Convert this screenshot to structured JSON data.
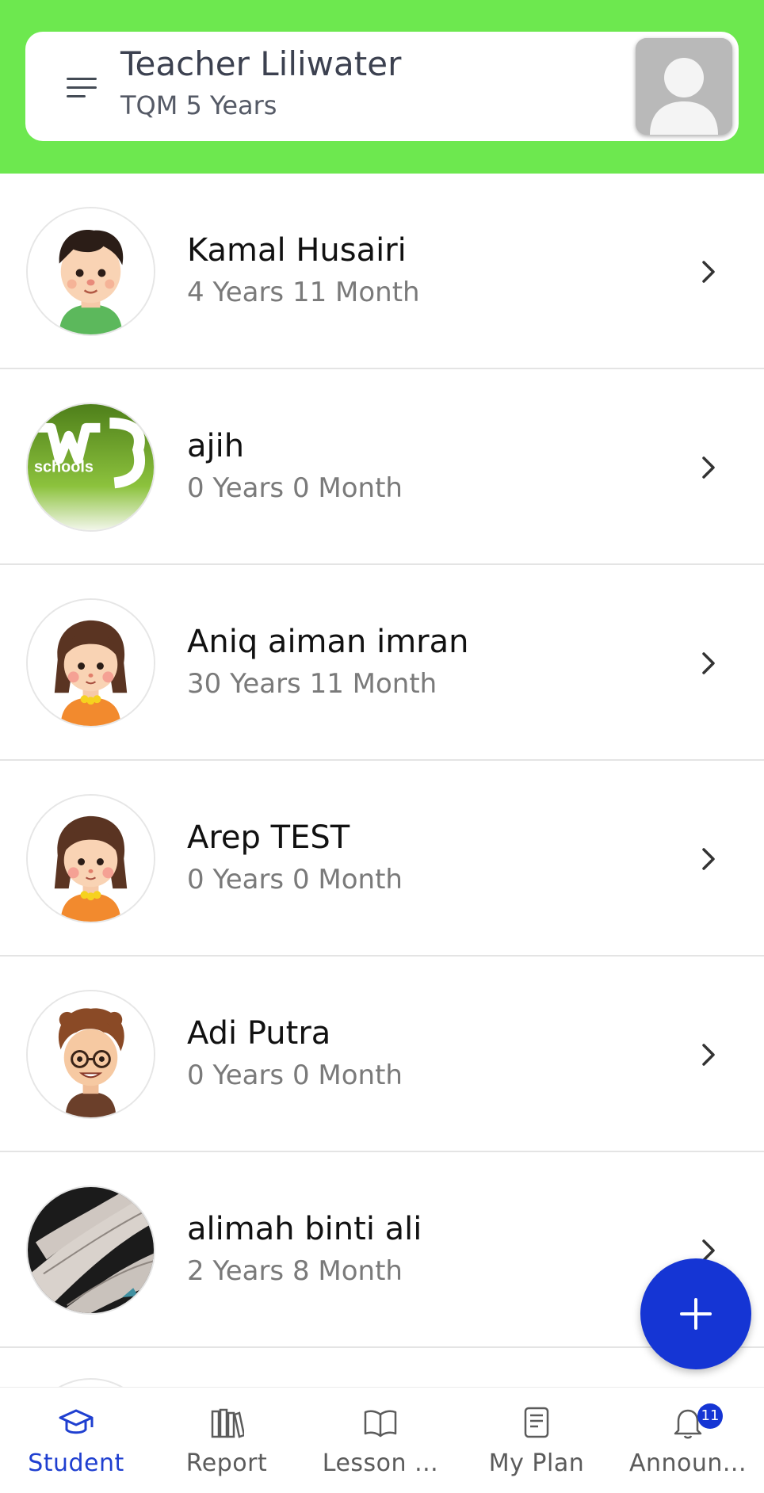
{
  "header": {
    "teacher_name": "Teacher Liliwater",
    "teacher_subtitle": "TQM 5 Years",
    "background_color": "#6de84f"
  },
  "students": [
    {
      "name": "Kamal Husairi",
      "age": "4 Years 11 Month",
      "avatar": "cartoon-boy-avatar"
    },
    {
      "name": "ajih",
      "age": "0 Years 0 Month",
      "avatar": "w3schools-logo-avatar",
      "avatar_text": "schools"
    },
    {
      "name": "Aniq aiman imran",
      "age": "30 Years 11 Month",
      "avatar": "cartoon-girl-avatar"
    },
    {
      "name": "Arep TEST",
      "age": "0 Years 0 Month",
      "avatar": "cartoon-girl-avatar"
    },
    {
      "name": "Adi Putra",
      "age": "0 Years 0 Month",
      "avatar": "cartoon-boy-glasses-avatar"
    },
    {
      "name": "alimah binti ali",
      "age": "2 Years 8 Month",
      "avatar": "hand-photo-avatar"
    }
  ],
  "fab": {
    "icon": "plus-icon",
    "color": "#1535d4"
  },
  "bottom_nav": {
    "items": [
      {
        "label": "Student",
        "icon": "graduation-cap-icon",
        "active": true
      },
      {
        "label": "Report",
        "icon": "books-icon",
        "active": false
      },
      {
        "label": "Lesson ...",
        "icon": "open-book-icon",
        "active": false
      },
      {
        "label": "My Plan",
        "icon": "document-icon",
        "active": false
      },
      {
        "label": "Announ...",
        "icon": "bell-icon",
        "active": false,
        "badge": "11"
      }
    ],
    "active_color": "#1f3fd0"
  }
}
